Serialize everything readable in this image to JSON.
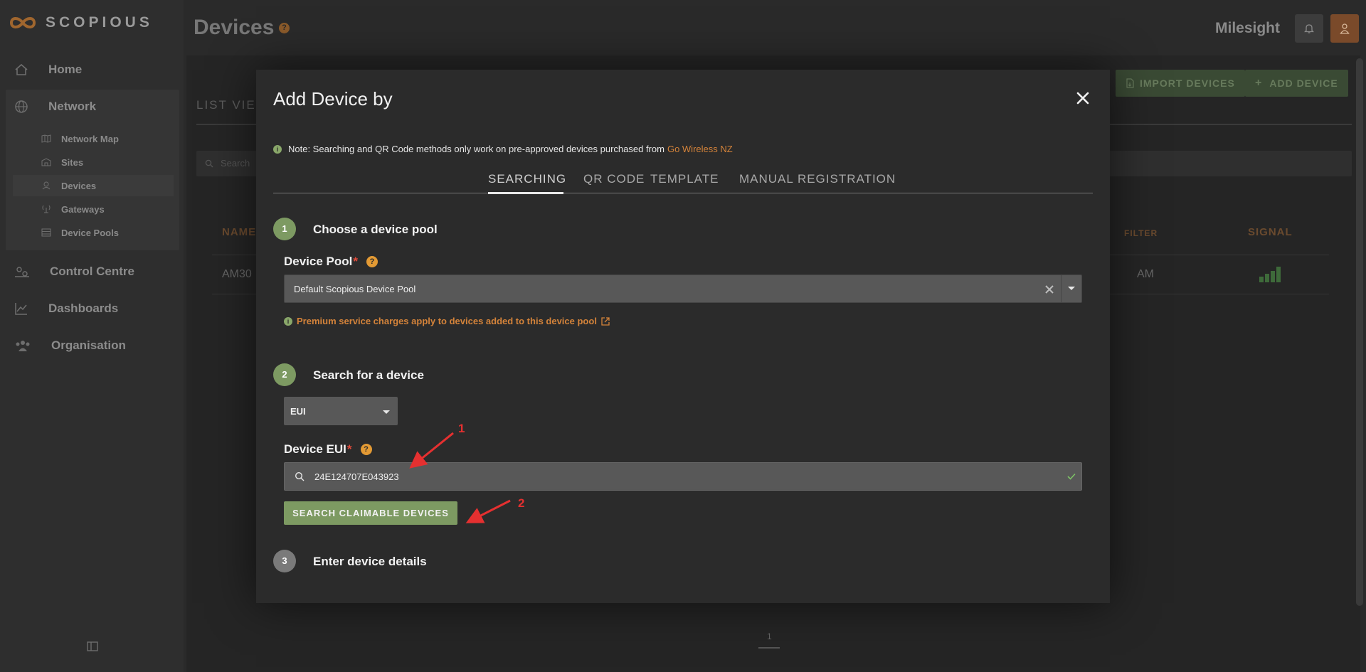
{
  "sidebar": {
    "logo": "SCOPIOUS",
    "nav": [
      {
        "label": "Home",
        "icon": "home-icon"
      },
      {
        "label": "Network",
        "icon": "globe-icon"
      },
      {
        "label": "Control Centre",
        "icon": "control-icon"
      },
      {
        "label": "Dashboards",
        "icon": "chart-line-icon"
      },
      {
        "label": "Organisation",
        "icon": "people-icon"
      }
    ],
    "network_sub": [
      {
        "label": "Network Map",
        "icon": "map-icon"
      },
      {
        "label": "Sites",
        "icon": "building-icon"
      },
      {
        "label": "Devices",
        "icon": "device-icon"
      },
      {
        "label": "Gateways",
        "icon": "antenna-icon"
      },
      {
        "label": "Device Pools",
        "icon": "pool-icon"
      }
    ]
  },
  "header": {
    "title": "Devices",
    "help": "?",
    "org": "Milesight"
  },
  "background": {
    "import_label": "IMPORT DEVICES",
    "add_label": "ADD DEVICE",
    "tab_label": "LIST VIEW",
    "search_placeholder": "Search",
    "col_name": "NAME",
    "col_filter": "FILTER",
    "col_signal": "SIGNAL",
    "row_name": "AM30",
    "row_time": "AM",
    "page": "1"
  },
  "modal": {
    "title": "Add Device by",
    "note_text": "Note: Searching and QR Code methods only work on pre-approved devices purchased from",
    "note_link": "Go Wireless NZ",
    "tabs": [
      "SEARCHING",
      "QR CODE",
      "TEMPLATE",
      "MANUAL REGISTRATION"
    ],
    "step1": {
      "num": "1",
      "label": "Choose a device pool"
    },
    "pool_label": "Device Pool",
    "required_mark": "*",
    "help_mark": "?",
    "pool_value": "Default Scopious Device Pool",
    "premium_note": "Premium service charges apply to devices added to this device pool",
    "step2": {
      "num": "2",
      "label": "Search for a device"
    },
    "search_type": "EUI",
    "eui_label": "Device EUI",
    "eui_value": "24E124707E043923",
    "search_button": "SEARCH CLAIMABLE DEVICES",
    "step3": {
      "num": "3",
      "label": "Enter device details"
    }
  },
  "annotations": [
    "1",
    "2"
  ]
}
